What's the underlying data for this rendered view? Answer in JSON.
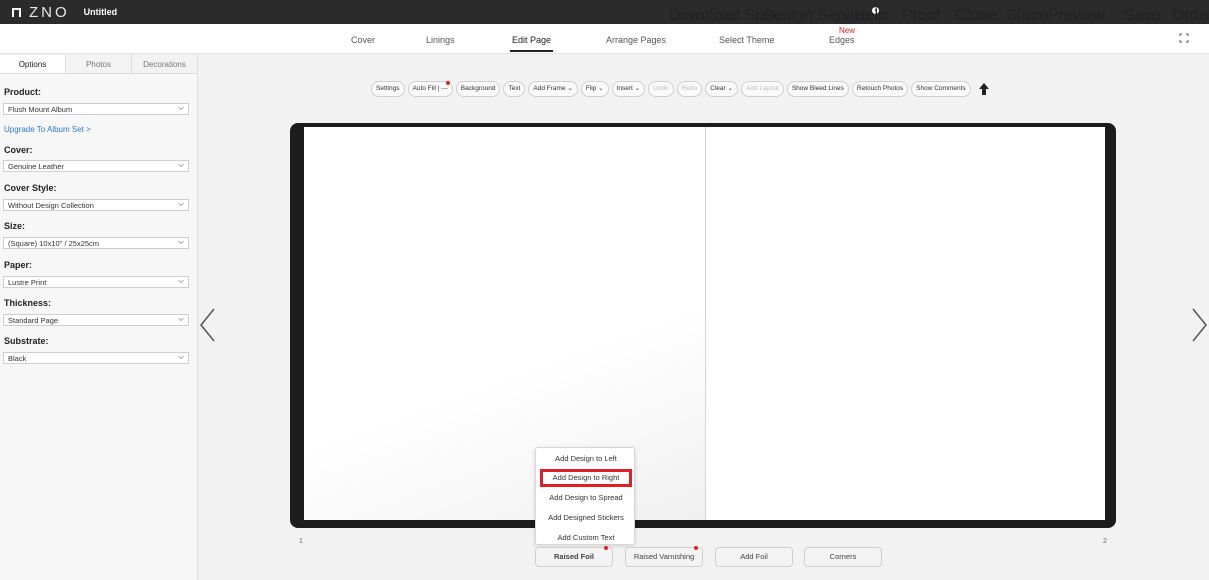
{
  "topbar": {
    "logo_text": "ZNO",
    "doc_title": "Untitled",
    "actions": [
      "Download Spec",
      "Design Service",
      "Help",
      "Proof",
      "Clone",
      "Share",
      "Preview",
      "Save",
      "Order"
    ]
  },
  "nav": {
    "items": [
      "Cover",
      "Linings",
      "Edit Page",
      "Arrange Pages",
      "Select Theme",
      "Edges"
    ],
    "active": "Edit Page",
    "new_badge": "New"
  },
  "sidebar": {
    "tabs": [
      "Options",
      "Photos",
      "Decorations"
    ],
    "active_tab": "Options",
    "product_label": "Product:",
    "product_value": "Flush Mount Album",
    "upgrade_link": "Upgrade To Album Set >",
    "cover_label": "Cover:",
    "cover_value": "Genuine Leather",
    "cover_style_label": "Cover Style:",
    "cover_style_value": "Without Design Collection",
    "size_label": "Size:",
    "size_value": "(Square) 10x10\" / 25x25cm",
    "paper_label": "Paper:",
    "paper_value": "Lustre Print",
    "thickness_label": "Thickness:",
    "thickness_value": "Standard Page",
    "substrate_label": "Substrate:",
    "substrate_value": "Black"
  },
  "toolbar": {
    "buttons": [
      "Settings",
      "Auto Fill | ---",
      "Background",
      "Text",
      "Add Frame ⌄",
      "Flip ⌄",
      "Insert ⌄",
      "Undo",
      "Redo",
      "Clear ⌄",
      "Add Layout",
      "Show Bleed Lines",
      "Retouch Photos",
      "Show Comments"
    ],
    "disabled": [
      "Undo",
      "Redo",
      "Add Layout"
    ]
  },
  "pages": {
    "left_number": "1",
    "right_number": "2"
  },
  "popup": {
    "items": [
      "Add Design to Left",
      "Add Design to Right",
      "Add Design to Spread",
      "Add Designed Stickers",
      "Add Custom Text"
    ],
    "highlighted": "Add Design to Right"
  },
  "bottom_buttons": [
    "Raised Foil",
    "Raised Varnishing",
    "Add Foil",
    "Corners"
  ],
  "colors": {
    "topbar": "#2b2b2b",
    "highlight": "#e01f26",
    "link": "#2d7ad6",
    "dot": "#e02020"
  }
}
